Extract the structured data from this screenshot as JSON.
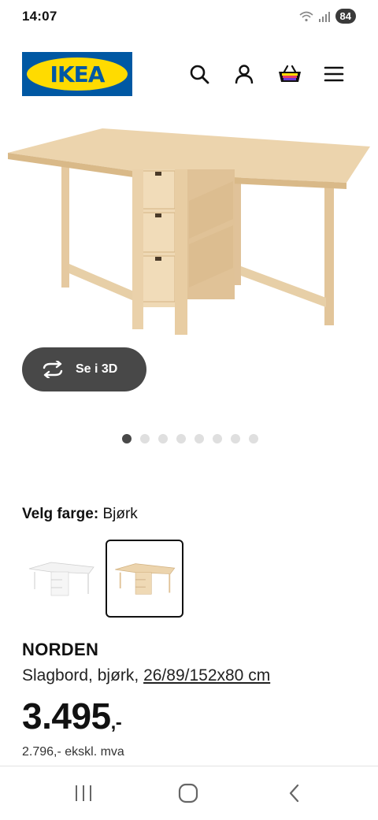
{
  "status_bar": {
    "time": "14:07",
    "battery": "84"
  },
  "header": {
    "logo_text": "IKEA",
    "brand_blue": "#0058a3",
    "brand_yellow": "#ffdb00",
    "icons": [
      "search-icon",
      "user-icon",
      "cart-icon",
      "menu-icon"
    ]
  },
  "gallery": {
    "view_3d_label": "Se i 3D",
    "image_count": 8,
    "active_index": 1
  },
  "color_picker": {
    "label": "Velg farge:",
    "selected_value": "Bjørk",
    "options": [
      "white",
      "birch"
    ],
    "selected_index": 2
  },
  "product": {
    "name": "NORDEN",
    "description": "Slagbord, bjørk, ",
    "dimensions": "26/89/152x80 cm",
    "price_main": "3.495",
    "price_suffix": ",-",
    "price_ex_vat": "2.796,- ekskl. mva"
  },
  "system_nav": {
    "icons": [
      "recent-apps-icon",
      "home-icon",
      "back-icon"
    ]
  }
}
